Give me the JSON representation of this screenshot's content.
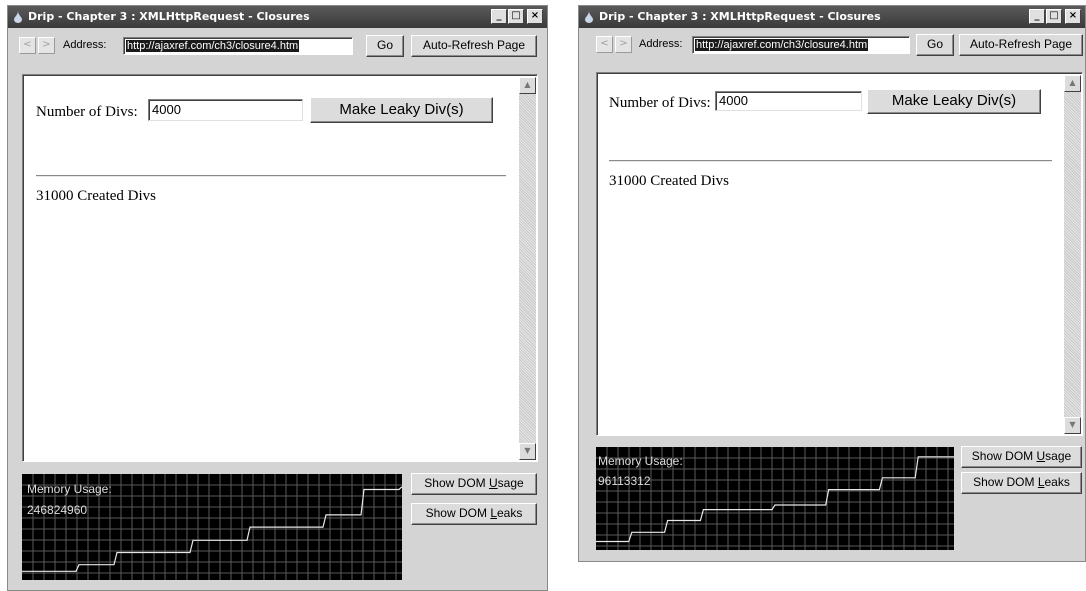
{
  "windows": [
    {
      "title": "Drip - Chapter 3 : XMLHttpRequest - Closures",
      "window_buttons": {
        "minimize": "_",
        "maximize": "□",
        "close": "×"
      },
      "back_glyph": "<",
      "forward_glyph": ">",
      "address_label": "Address:",
      "address_value": "http://ajaxref.com/ch3/closure4.htm",
      "go_label": "Go",
      "auto_refresh_label": "Auto-Refresh Page",
      "page": {
        "num_divs_label": "Number of Divs:",
        "num_divs_value": "4000",
        "make_button_label": "Make Leaky Div(s)",
        "status_text": "31000 Created Divs"
      },
      "memory_label": "Memory Usage:",
      "memory_value": "246824960",
      "show_usage_label": "Show DOM Usage",
      "show_leaks_label": "Show DOM Leaks",
      "memory_series": [
        0.05,
        0.05,
        0.05,
        0.12,
        0.12,
        0.25,
        0.25,
        0.25,
        0.25,
        0.38,
        0.38,
        0.38,
        0.52,
        0.52,
        0.52,
        0.52,
        0.65,
        0.65,
        0.92,
        0.92,
        0.95
      ]
    },
    {
      "title": "Drip - Chapter 3 : XMLHttpRequest - Closures",
      "window_buttons": {
        "minimize": "_",
        "maximize": "□",
        "close": "×"
      },
      "back_glyph": "<",
      "forward_glyph": ">",
      "address_label": "Address:",
      "address_value": "http://ajaxref.com/ch3/closure4.htm",
      "go_label": "Go",
      "auto_refresh_label": "Auto-Refresh Page",
      "page": {
        "num_divs_label": "Number of Divs:",
        "num_divs_value": "4000",
        "make_button_label": "Make Leaky Div(s)",
        "status_text": "31000 Created Divs"
      },
      "memory_label": "Memory Usage:",
      "memory_value": "96113312",
      "show_usage_label": "Show DOM Usage",
      "show_leaks_label": "Show DOM Leaks",
      "memory_series": [
        0.05,
        0.05,
        0.15,
        0.15,
        0.28,
        0.28,
        0.4,
        0.4,
        0.4,
        0.4,
        0.45,
        0.45,
        0.45,
        0.62,
        0.62,
        0.62,
        0.75,
        0.75,
        0.98,
        0.98,
        0.98
      ]
    }
  ]
}
